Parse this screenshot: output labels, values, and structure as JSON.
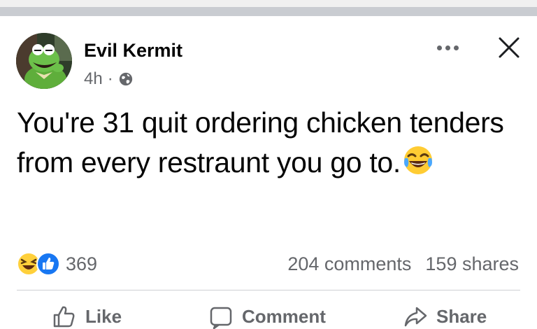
{
  "post": {
    "author": "Evil Kermit",
    "time": "4h",
    "separator": "·",
    "text": "You're 31 quit ordering chicken tenders from every restraunt you go to."
  },
  "reactions": {
    "count": "369",
    "icons": [
      "laughing-face-icon",
      "thumbs-up-icon"
    ]
  },
  "stats": {
    "comments": "204 comments",
    "shares": "159 shares"
  },
  "actions": {
    "like": "Like",
    "comment": "Comment",
    "share": "Share"
  },
  "colors": {
    "secondary_text": "#65676b",
    "like_blue": "#1877f2",
    "divider": "#ced0d4"
  }
}
